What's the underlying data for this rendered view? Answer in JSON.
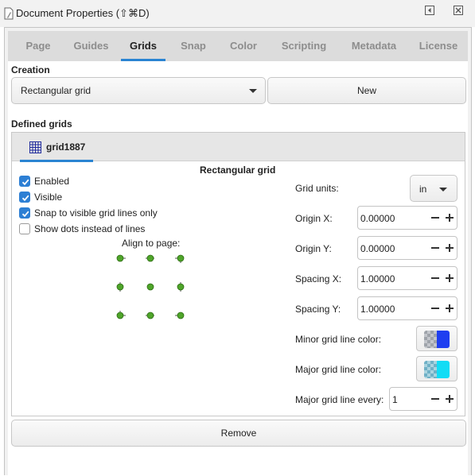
{
  "window": {
    "title": "Document Properties (⇧⌘D)"
  },
  "tabs": [
    {
      "label": "Page"
    },
    {
      "label": "Guides"
    },
    {
      "label": "Grids",
      "active": true
    },
    {
      "label": "Snap"
    },
    {
      "label": "Color"
    },
    {
      "label": "Scripting"
    },
    {
      "label": "Metadata"
    },
    {
      "label": "License"
    }
  ],
  "creation": {
    "heading": "Creation",
    "grid_type": "Rectangular grid",
    "new_label": "New"
  },
  "defined_grids": {
    "heading": "Defined grids",
    "tab_label": "grid1887",
    "panel_title": "Rectangular grid",
    "checkboxes": [
      {
        "label": "Enabled",
        "checked": true
      },
      {
        "label": "Visible",
        "checked": true
      },
      {
        "label": "Snap to visible grid lines only",
        "checked": true
      },
      {
        "label": "Show dots instead of lines",
        "checked": false
      }
    ],
    "align_label": "Align to page:",
    "grid_units_label": "Grid units:",
    "grid_units_value": "in",
    "origin_x_label": "Origin X:",
    "origin_x": "0.00000",
    "origin_y_label": "Origin Y:",
    "origin_y": "0.00000",
    "spacing_x_label": "Spacing X:",
    "spacing_x": "1.00000",
    "spacing_y_label": "Spacing Y:",
    "spacing_y": "1.00000",
    "minor_color_label": "Minor grid line color:",
    "minor_color": "#1f3ff0",
    "major_color_label": "Major grid line color:",
    "major_color": "#12dcf5",
    "major_every_label": "Major grid line every:",
    "major_every": "1"
  },
  "remove_label": "Remove",
  "colors": {
    "accent": "#2a84d2",
    "checkbox": "#2d7fd4",
    "anchor": "#4fa52a"
  }
}
